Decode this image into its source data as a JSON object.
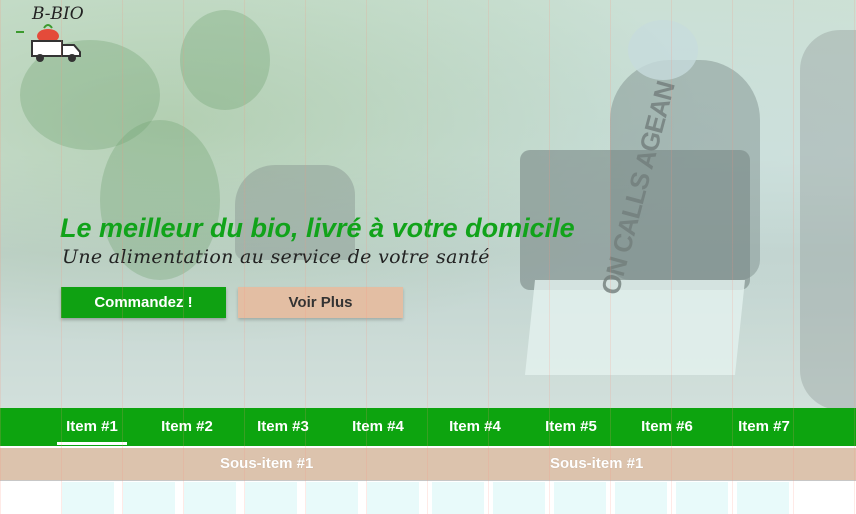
{
  "brand": {
    "logo_text": "B-BIO",
    "colors": {
      "green": "#0fa112",
      "beige": "#e3bea3",
      "nav": "#0da40f"
    }
  },
  "hero": {
    "headline": "Le meilleur du bio, livré à votre domicile",
    "subline": "Une alimentation au service de votre santé",
    "background_text": "ON CALLS AGEAN",
    "buttons": {
      "order": "Commandez !",
      "more": "Voir Plus"
    }
  },
  "nav": {
    "items": [
      {
        "label": "Item #1",
        "active": true
      },
      {
        "label": "Item #2"
      },
      {
        "label": "Item #3"
      },
      {
        "label": "Item #4"
      },
      {
        "label": "Item #4"
      },
      {
        "label": "Item #5"
      },
      {
        "label": "Item #6"
      },
      {
        "label": "Item #7"
      }
    ]
  },
  "subnav": {
    "items": [
      {
        "label": "Sous-item #1"
      },
      {
        "label": "Sous-item #1"
      }
    ]
  }
}
